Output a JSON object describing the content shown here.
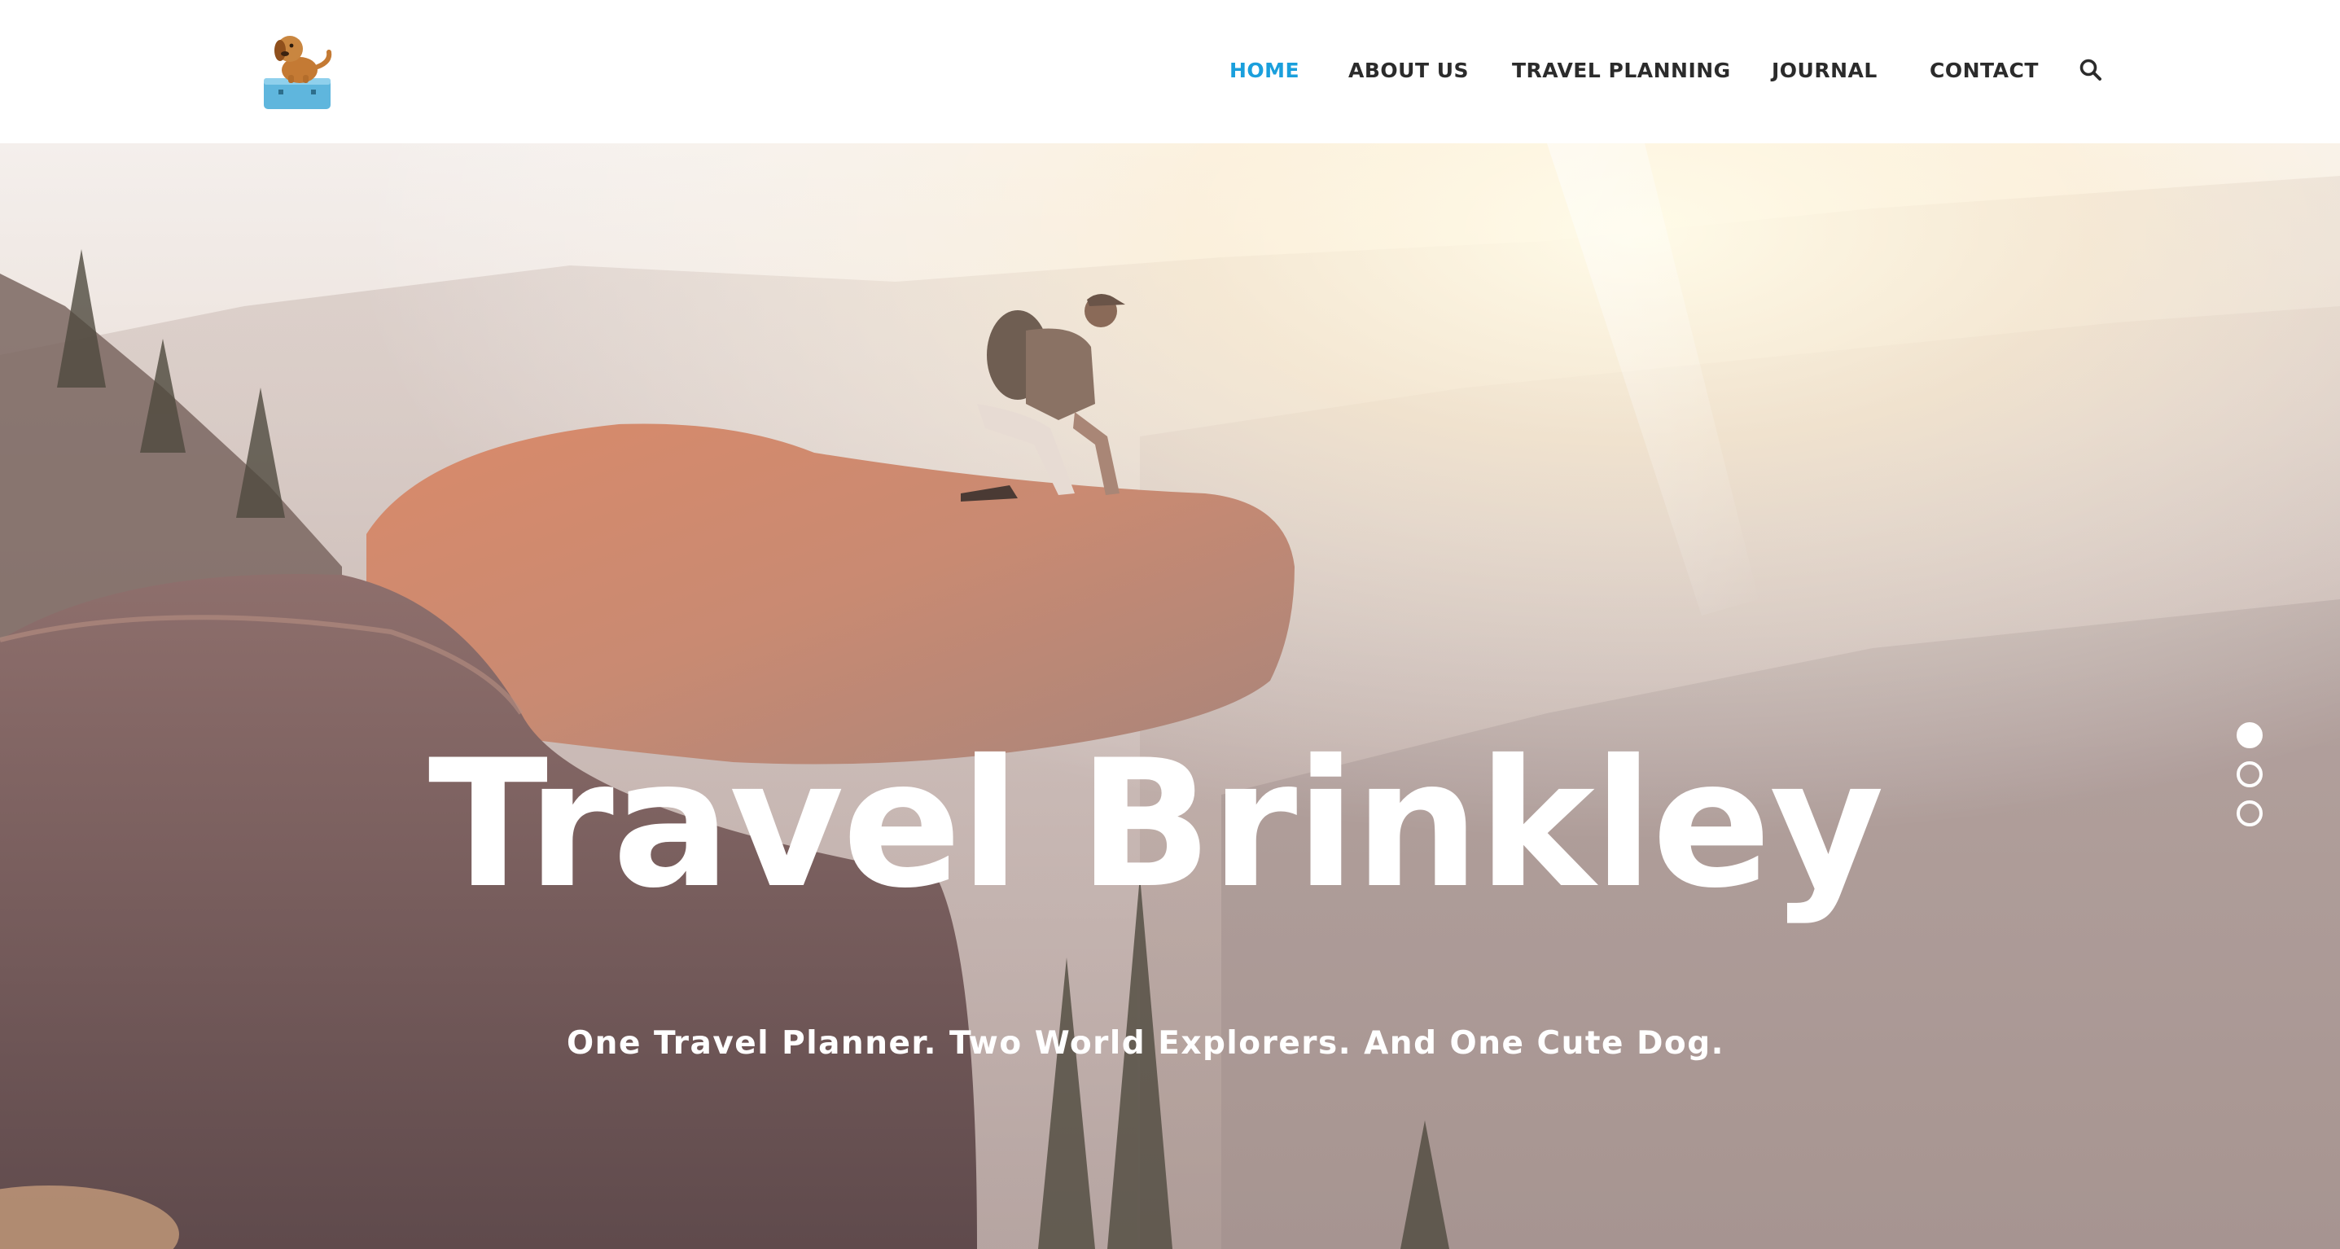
{
  "header": {
    "logo_icon": "dog-on-suitcase-logo",
    "nav": [
      {
        "label": "HOME",
        "active": true
      },
      {
        "label": "ABOUT US",
        "active": false
      },
      {
        "label": "TRAVEL PLANNING",
        "active": false
      },
      {
        "label": "JOURNAL",
        "active": false
      },
      {
        "label": "CONTACT",
        "active": false
      }
    ],
    "search_icon": "search-icon"
  },
  "hero": {
    "title": "Travel Brinkley",
    "subtitle": "One Travel Planner. Two World Explorers. And One Cute Dog.",
    "background_description_icon": "hiker-on-rock-photo",
    "slides": {
      "count": 3,
      "active_index": 0
    }
  },
  "colors": {
    "accent": "#1a9fdc",
    "nav_text": "#2b2b2b",
    "hero_text": "#ffffff"
  }
}
